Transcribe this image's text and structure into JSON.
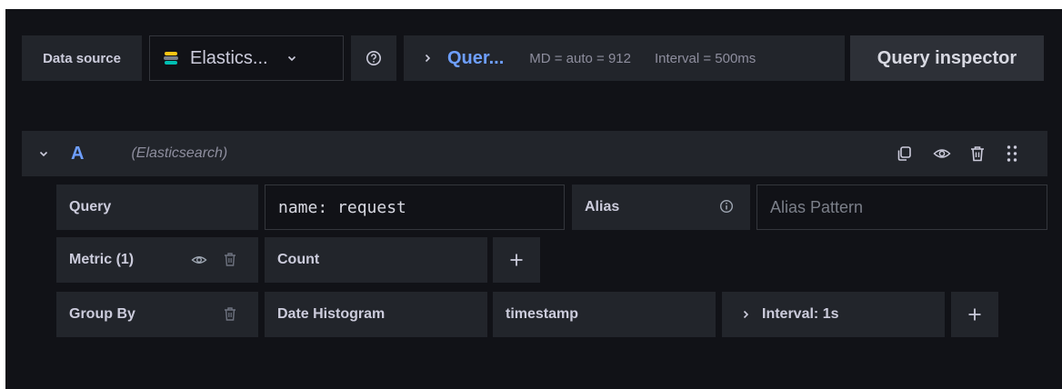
{
  "toolbar": {
    "data_source_label": "Data source",
    "datasource_name": "Elastics...",
    "query_options_label": "Quer...",
    "max_data_points": "MD = auto = 912",
    "interval": "Interval = 500ms",
    "inspector_label": "Query inspector"
  },
  "query_row": {
    "ref_id": "A",
    "datasource": "(Elasticsearch)"
  },
  "fields": {
    "query_label": "Query",
    "query_value": "name: request",
    "alias_label": "Alias",
    "alias_placeholder": "Alias Pattern",
    "metric_label": "Metric (1)",
    "metric_type": "Count",
    "group_by_label": "Group By",
    "group_by_type": "Date Histogram",
    "group_by_field": "timestamp",
    "group_by_interval": "Interval: 1s"
  },
  "colors": {
    "background": "#111217",
    "field": "#22252b",
    "link_blue": "#6e9fff",
    "elastic_yellow": "#fec514",
    "elastic_teal": "#00bfb3"
  }
}
